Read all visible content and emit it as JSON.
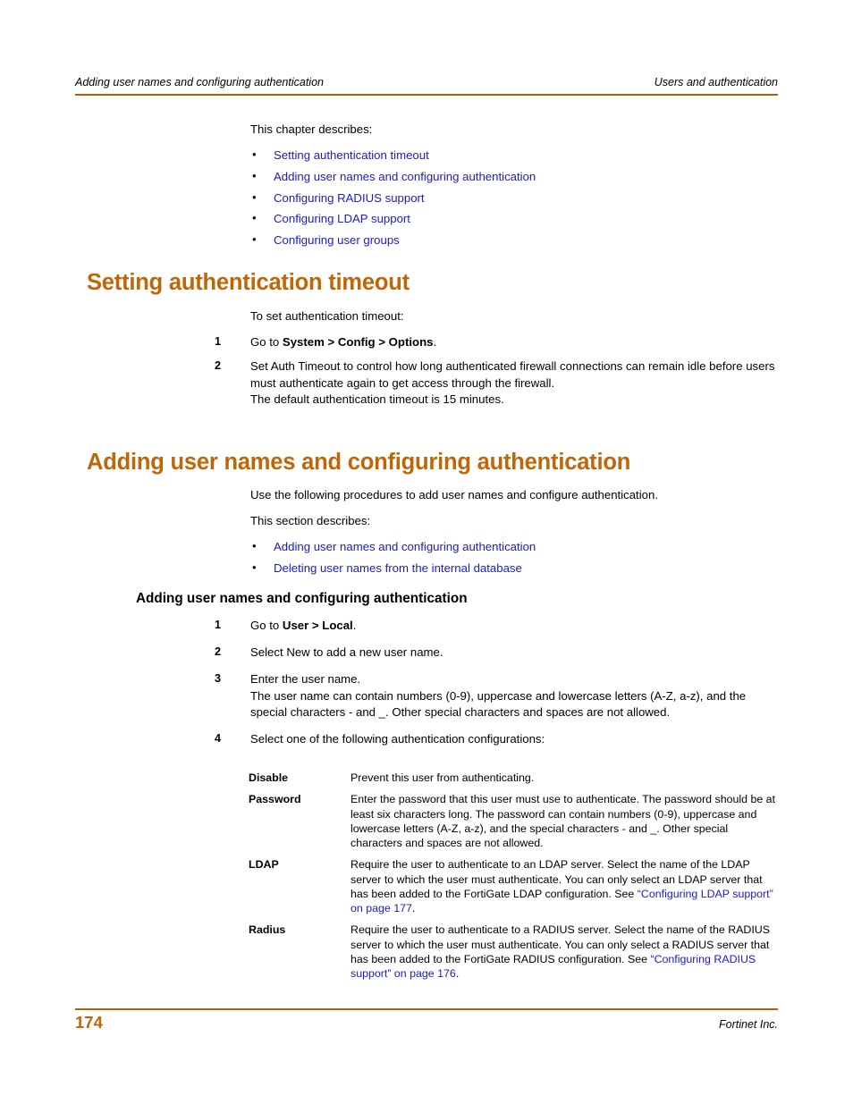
{
  "header": {
    "left": "Adding user names and configuring authentication",
    "right": "Users and authentication"
  },
  "intro": {
    "lead": "This chapter describes:",
    "links": [
      "Setting authentication timeout",
      "Adding user names and configuring authentication",
      "Configuring RADIUS support",
      "Configuring LDAP support",
      "Configuring user groups"
    ]
  },
  "section1": {
    "heading": "Setting authentication timeout",
    "lead": "To set authentication timeout:",
    "steps": [
      {
        "num": "1",
        "pre": "Go to ",
        "bold": "System > Config > Options",
        "post": ".",
        "extra": []
      },
      {
        "num": "2",
        "pre": "Set Auth Timeout to control how long authenticated firewall connections can remain idle before users must authenticate again to get access through the firewall.",
        "bold": "",
        "post": "",
        "extra": [
          "The default authentication timeout is 15 minutes."
        ]
      }
    ]
  },
  "section2": {
    "heading": "Adding user names and configuring authentication",
    "lead1": "Use the following procedures to add user names and configure authentication.",
    "lead2": "This section describes:",
    "links": [
      "Adding user names and configuring authentication",
      "Deleting user names from the internal database"
    ],
    "subheading": "Adding user names and configuring authentication",
    "steps": [
      {
        "num": "1",
        "pre": "Go to ",
        "bold": "User > Local",
        "post": ".",
        "extra": []
      },
      {
        "num": "2",
        "pre": "Select New to add a new user name.",
        "bold": "",
        "post": "",
        "extra": []
      },
      {
        "num": "3",
        "pre": "Enter the user name.",
        "bold": "",
        "post": "",
        "extra": [
          "The user name can contain numbers (0-9), uppercase and lowercase letters (A-Z, a-z), and the special characters - and _. Other special characters and spaces are not allowed."
        ]
      },
      {
        "num": "4",
        "pre": "Select one of the following authentication configurations:",
        "bold": "",
        "post": "",
        "extra": []
      }
    ],
    "definitions": [
      {
        "term": "Disable",
        "desc": "Prevent this user from authenticating.",
        "link_pre": "",
        "link": "",
        "link_post": ""
      },
      {
        "term": "Password",
        "desc": "Enter the password that this user must use to authenticate. The password should be at least six characters long. The password can contain numbers (0-9), uppercase and lowercase letters (A-Z, a-z), and the special characters - and _. Other special characters and spaces are not allowed.",
        "link_pre": "",
        "link": "",
        "link_post": ""
      },
      {
        "term": "LDAP",
        "desc": "Require the user to authenticate to an LDAP server. Select the name of the LDAP server to which the user must authenticate. You can only select an LDAP server that has been added to the FortiGate LDAP configuration. See ",
        "link_pre": "",
        "link": "“Configuring LDAP support” on page 177",
        "link_post": "."
      },
      {
        "term": "Radius",
        "desc": "Require the user to authenticate to a RADIUS server. Select the name of the RADIUS server to which the user must authenticate. You can only select a RADIUS server that has been added to the FortiGate RADIUS configuration. See ",
        "link_pre": "",
        "link": "“Configuring RADIUS support” on page 176",
        "link_post": "."
      }
    ]
  },
  "footer": {
    "page_number": "174",
    "company": "Fortinet Inc."
  },
  "colors": {
    "heading_orange": "#c06606",
    "rule_orange": "#b26104",
    "link_blue": "#1a1ad0",
    "text_black": "#000000"
  }
}
